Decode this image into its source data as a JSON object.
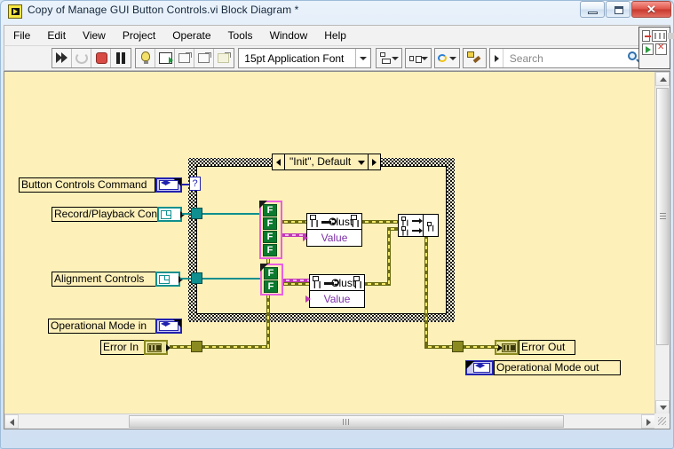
{
  "window": {
    "title": "Copy of Manage GUI Button Controls.vi Block Diagram *",
    "icon": "labview-vi-icon",
    "buttons": {
      "minimize": "minimize-icon",
      "maximize": "maximize-icon",
      "close": "✕"
    }
  },
  "menubar": {
    "items": [
      {
        "label": "File",
        "accel": "F"
      },
      {
        "label": "Edit",
        "accel": "E"
      },
      {
        "label": "View",
        "accel": "V"
      },
      {
        "label": "Project",
        "accel": "P"
      },
      {
        "label": "Operate",
        "accel": "O"
      },
      {
        "label": "Tools",
        "accel": "T"
      },
      {
        "label": "Window",
        "accel": "W"
      },
      {
        "label": "Help",
        "accel": "H"
      }
    ]
  },
  "toolbar": {
    "run_button": "run-arrow-icon",
    "run_continuously_button": "run-continuously-icon",
    "abort_button": "abort-execution-icon",
    "pause_button": "pause-icon",
    "highlight_execution_button": "light-bulb-icon",
    "retain_wire_values_button": "probe-retain-icon",
    "step_into_button": "step-into-icon",
    "step_over_button": "step-over-icon",
    "step_out_button": "step-out-icon",
    "font_selector": "15pt Application Font",
    "align_objects_button": "align-objects-icon",
    "distribute_objects_button": "distribute-objects-icon",
    "reorder_button": "reorder-icon",
    "clean_up_diagram_button": "clean-up-diagram-icon",
    "search_placeholder": "Search",
    "search_value": "",
    "search_icon": "magnifier-icon",
    "help_button": "context-help-icon"
  },
  "connector_pane": {
    "name": "vi-icon-connector-pane"
  },
  "diagram": {
    "background_color": "#fdf0b8",
    "case_structure": {
      "selector_label": "\"Init\", Default",
      "selector_left_arrow": "previous-case-icon",
      "selector_right_arrow": "next-case-icon",
      "selector_dropdown": "chevron-down-icon",
      "case_selector_terminal": "?"
    },
    "controls": [
      {
        "label": "Button Controls Command",
        "terminal_type": "enum",
        "terminal_icon": "enum-terminal-icon"
      },
      {
        "label": "Record/Playback Controls",
        "terminal_type": "cluster",
        "terminal_icon": "cluster-terminal-icon"
      },
      {
        "label": "Alignment Controls",
        "terminal_type": "cluster",
        "terminal_icon": "cluster-terminal-icon"
      },
      {
        "label": "Operational Mode in",
        "terminal_type": "enum",
        "terminal_icon": "enum-terminal-icon"
      },
      {
        "label": "Error In",
        "terminal_type": "error-cluster",
        "terminal_icon": "error-cluster-terminal-icon"
      }
    ],
    "indicators": [
      {
        "label": "Error Out",
        "terminal_type": "error-cluster",
        "terminal_icon": "error-cluster-terminal-icon"
      },
      {
        "label": "Operational Mode out",
        "terminal_type": "enum",
        "terminal_icon": "enum-terminal-icon"
      }
    ],
    "constants": [
      {
        "name": "boolean-array-constant-1",
        "values": [
          "F",
          "F",
          "F",
          "F"
        ],
        "border_color": "#ea5fe0"
      },
      {
        "name": "boolean-array-constant-2",
        "values": [
          "F",
          "F"
        ],
        "border_color": "#ea5fe0"
      }
    ],
    "nodes": [
      {
        "name": "bundle-by-name-1",
        "rows": [
          "Clust",
          "Value"
        ]
      },
      {
        "name": "bundle-by-name-2",
        "rows": [
          "Clust",
          "Value"
        ]
      },
      {
        "name": "merge-errors",
        "label": ""
      }
    ]
  },
  "scrollbars": {
    "vertical": "vertical-scrollbar",
    "horizontal": "horizontal-scrollbar"
  }
}
